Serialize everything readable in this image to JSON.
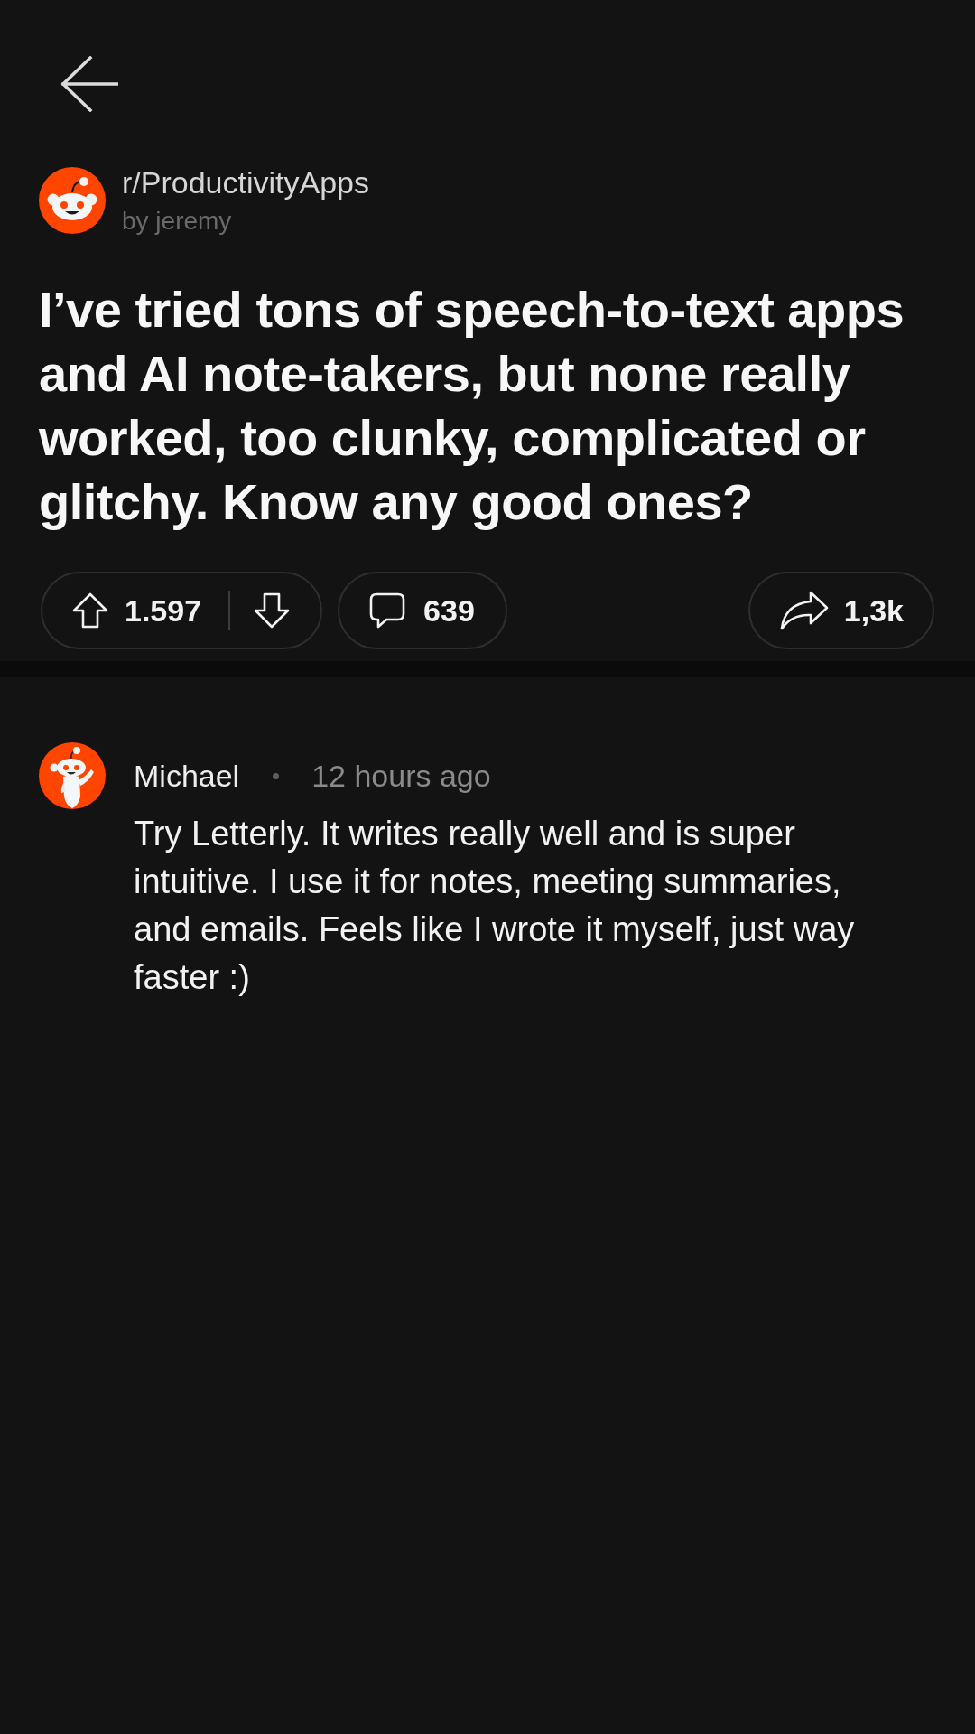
{
  "post": {
    "subreddit": "r/ProductivityApps",
    "author": "by jeremy",
    "title": "I’ve tried tons of speech-to-text apps and AI note-takers, but none really worked, too clunky, complicated or glitchy. Know any good ones?",
    "votes": "1.597",
    "comments": "639",
    "shares": "1,3k"
  },
  "comments": [
    {
      "author": "Michael",
      "time": "12 hours ago",
      "body": "Try Letterly. It writes really well and is super intuitive. I use it for notes, meeting summaries, and emails. Feels like I wrote it myself, just way faster :)"
    }
  ]
}
